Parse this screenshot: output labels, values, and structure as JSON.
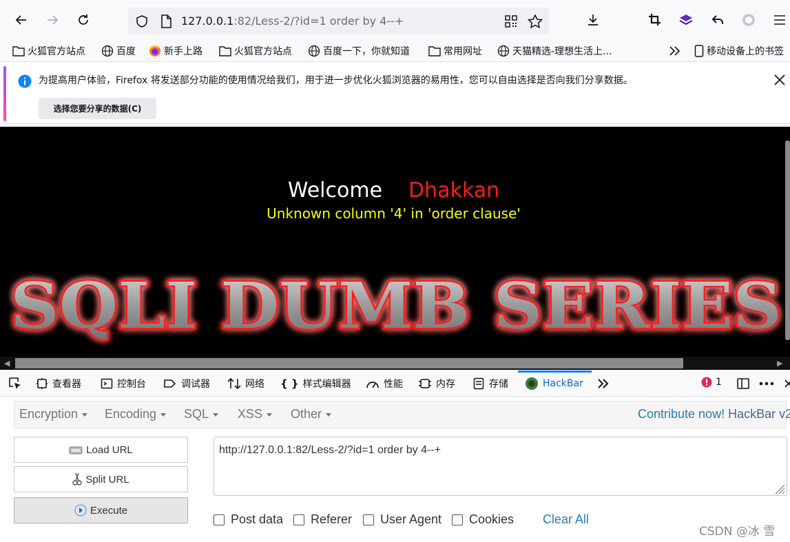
{
  "browser": {
    "url_host": "127.0.0.1",
    "url_rest": ":82/Less-2/?id=1 order by 4--+"
  },
  "bookmarks": [
    {
      "icon": "folder-icon",
      "label": "火狐官方站点"
    },
    {
      "icon": "globe-icon",
      "label": "百度"
    },
    {
      "icon": "firefox-icon",
      "label": "新手上路"
    },
    {
      "icon": "folder-icon",
      "label": "火狐官方站点"
    },
    {
      "icon": "globe-icon",
      "label": "百度一下，你就知道"
    },
    {
      "icon": "folder-icon",
      "label": "常用网址"
    },
    {
      "icon": "globe-icon",
      "label": "天猫精选-理想生活上..."
    },
    {
      "icon": "mobile-icon",
      "label": "移动设备上的书签"
    }
  ],
  "notification": {
    "text": "为提高用户体验，Firefox 将发送部分功能的使用情况给我们，用于进一步优化火狐浏览器的易用性，您可以自由选择是否向我们分享数据。",
    "button": "选择您要分享的数据(C)"
  },
  "page": {
    "welcome": "Welcome",
    "name": "Dhakkan",
    "error": "Unknown column '4' in 'order clause'",
    "logo_text": "SQLI DUMB SERIES"
  },
  "devtools": {
    "tabs": [
      {
        "icon": "inspector-icon",
        "label": "查看器"
      },
      {
        "icon": "console-icon",
        "label": "控制台"
      },
      {
        "icon": "debugger-icon",
        "label": "调试器"
      },
      {
        "icon": "network-icon",
        "label": "网络"
      },
      {
        "icon": "style-editor-icon",
        "label": "样式编辑器"
      },
      {
        "icon": "performance-icon",
        "label": "性能"
      },
      {
        "icon": "memory-icon",
        "label": "内存"
      },
      {
        "icon": "storage-icon",
        "label": "存储"
      },
      {
        "icon": "hackbar-icon",
        "label": "HackBar"
      }
    ],
    "error_count": "1"
  },
  "hackbar": {
    "menus": [
      "Encryption",
      "Encoding",
      "SQL",
      "XSS",
      "Other"
    ],
    "contribute": "Contribute now!",
    "brand": "HackBar v2",
    "load_url": "Load URL",
    "split_url": "Split URL",
    "execute": "Execute",
    "url_value": "http://127.0.0.1:82/Less-2/?id=1 order by 4--+",
    "options": [
      "Post data",
      "Referer",
      "User Agent",
      "Cookies"
    ],
    "clear_all": "Clear All"
  },
  "watermark": "CSDN @冰 雪",
  "colors": {
    "accent": "#0a84ff",
    "welcome_name": "#ff1a1a",
    "error_text": "#ffff00",
    "logo_glow": "#ff0000"
  }
}
